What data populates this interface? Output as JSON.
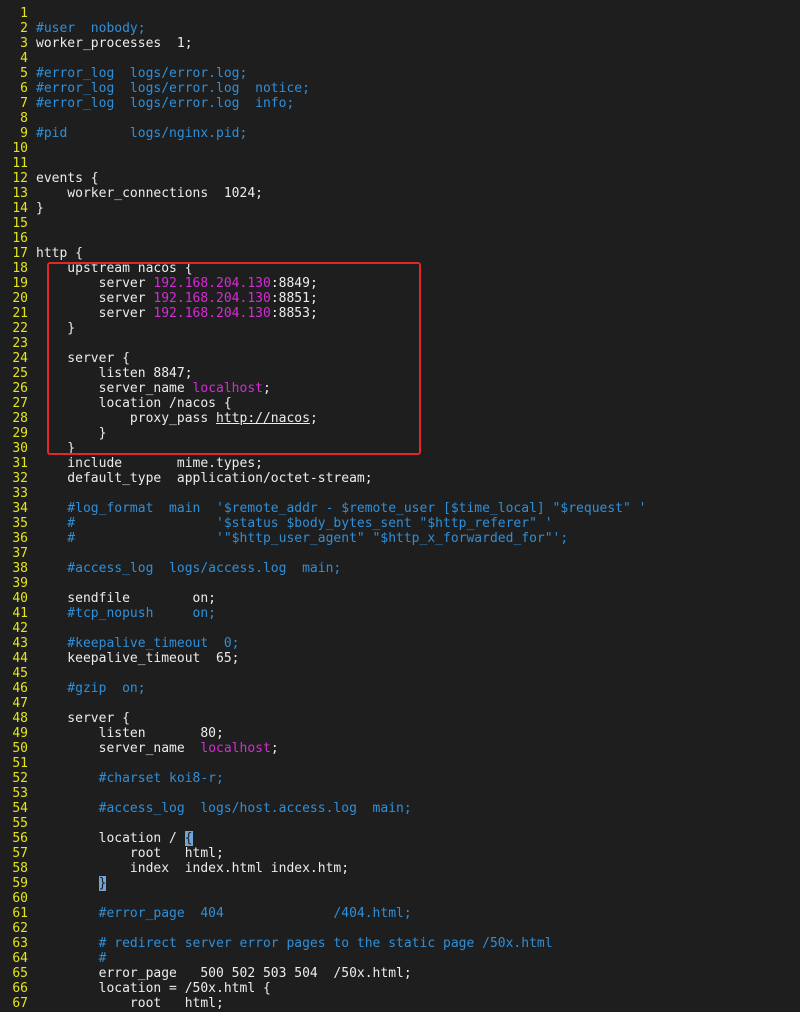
{
  "colors": {
    "background": "#1e1e1e",
    "line_number": "#e5e51c",
    "text": "#ececec",
    "comment": "#2f8fd8",
    "string": "#d62bd6",
    "highlight_box": "#e02828"
  },
  "lines": [
    {
      "n": "1",
      "segs": []
    },
    {
      "n": "2",
      "segs": [
        {
          "t": "#user  nobody;",
          "c": "c"
        }
      ]
    },
    {
      "n": "3",
      "segs": [
        {
          "t": "worker_processes  1;"
        }
      ]
    },
    {
      "n": "4",
      "segs": []
    },
    {
      "n": "5",
      "segs": [
        {
          "t": "#error_log  logs/error.log;",
          "c": "c"
        }
      ]
    },
    {
      "n": "6",
      "segs": [
        {
          "t": "#error_log  logs/error.log  notice;",
          "c": "c"
        }
      ]
    },
    {
      "n": "7",
      "segs": [
        {
          "t": "#error_log  logs/error.log  info;",
          "c": "c"
        }
      ]
    },
    {
      "n": "8",
      "segs": []
    },
    {
      "n": "9",
      "segs": [
        {
          "t": "#pid        logs/nginx.pid;",
          "c": "c"
        }
      ]
    },
    {
      "n": "10",
      "segs": []
    },
    {
      "n": "11",
      "segs": []
    },
    {
      "n": "12",
      "segs": [
        {
          "t": "events {"
        }
      ]
    },
    {
      "n": "13",
      "segs": [
        {
          "t": "    worker_connections  1024;"
        }
      ]
    },
    {
      "n": "14",
      "segs": [
        {
          "t": "}"
        }
      ]
    },
    {
      "n": "15",
      "segs": []
    },
    {
      "n": "16",
      "segs": []
    },
    {
      "n": "17",
      "segs": [
        {
          "t": "http {"
        }
      ]
    },
    {
      "n": "18",
      "segs": [
        {
          "t": "    upstream nacos {"
        }
      ]
    },
    {
      "n": "19",
      "segs": [
        {
          "t": "        server "
        },
        {
          "t": "192.168.204.130",
          "c": "m"
        },
        {
          "t": ":8849;"
        }
      ]
    },
    {
      "n": "20",
      "segs": [
        {
          "t": "        server "
        },
        {
          "t": "192.168.204.130",
          "c": "m"
        },
        {
          "t": ":8851;"
        }
      ]
    },
    {
      "n": "21",
      "segs": [
        {
          "t": "        server "
        },
        {
          "t": "192.168.204.130",
          "c": "m"
        },
        {
          "t": ":8853;"
        }
      ]
    },
    {
      "n": "22",
      "segs": [
        {
          "t": "    }"
        }
      ]
    },
    {
      "n": "23",
      "segs": []
    },
    {
      "n": "24",
      "segs": [
        {
          "t": "    server {"
        }
      ]
    },
    {
      "n": "25",
      "segs": [
        {
          "t": "        listen 8847;"
        }
      ]
    },
    {
      "n": "26",
      "segs": [
        {
          "t": "        server_name "
        },
        {
          "t": "localhost",
          "c": "m"
        },
        {
          "t": ";"
        }
      ]
    },
    {
      "n": "27",
      "segs": [
        {
          "t": "        location /nacos {"
        }
      ]
    },
    {
      "n": "28",
      "segs": [
        {
          "t": "            proxy_pass "
        },
        {
          "t": "http://nacos",
          "c": "u"
        },
        {
          "t": ";"
        }
      ]
    },
    {
      "n": "29",
      "segs": [
        {
          "t": "        }"
        }
      ]
    },
    {
      "n": "30",
      "segs": [
        {
          "t": "    }"
        }
      ]
    },
    {
      "n": "31",
      "segs": [
        {
          "t": "    include       mime.types;"
        }
      ]
    },
    {
      "n": "32",
      "segs": [
        {
          "t": "    default_type  application/octet-stream;"
        }
      ]
    },
    {
      "n": "33",
      "segs": []
    },
    {
      "n": "34",
      "segs": [
        {
          "t": "    #log_format  main  '$remote_addr - $remote_user [$time_local] \"$request\" '",
          "c": "c"
        }
      ]
    },
    {
      "n": "35",
      "segs": [
        {
          "t": "    #                  '$status $body_bytes_sent \"$http_referer\" '",
          "c": "c"
        }
      ]
    },
    {
      "n": "36",
      "segs": [
        {
          "t": "    #                  '\"$http_user_agent\" \"$http_x_forwarded_for\"';",
          "c": "c"
        }
      ]
    },
    {
      "n": "37",
      "segs": []
    },
    {
      "n": "38",
      "segs": [
        {
          "t": "    #access_log  logs/access.log  main;",
          "c": "c"
        }
      ]
    },
    {
      "n": "39",
      "segs": []
    },
    {
      "n": "40",
      "segs": [
        {
          "t": "    sendfile        on;"
        }
      ]
    },
    {
      "n": "41",
      "segs": [
        {
          "t": "    #tcp_nopush     on;",
          "c": "c"
        }
      ]
    },
    {
      "n": "42",
      "segs": []
    },
    {
      "n": "43",
      "segs": [
        {
          "t": "    #keepalive_timeout  0;",
          "c": "c"
        }
      ]
    },
    {
      "n": "44",
      "segs": [
        {
          "t": "    keepalive_timeout  65;"
        }
      ]
    },
    {
      "n": "45",
      "segs": []
    },
    {
      "n": "46",
      "segs": [
        {
          "t": "    #gzip  on;",
          "c": "c"
        }
      ]
    },
    {
      "n": "47",
      "segs": []
    },
    {
      "n": "48",
      "segs": [
        {
          "t": "    server {"
        }
      ]
    },
    {
      "n": "49",
      "segs": [
        {
          "t": "        listen       80;"
        }
      ]
    },
    {
      "n": "50",
      "segs": [
        {
          "t": "        server_name  "
        },
        {
          "t": "localhost",
          "c": "m"
        },
        {
          "t": ";"
        }
      ]
    },
    {
      "n": "51",
      "segs": []
    },
    {
      "n": "52",
      "segs": [
        {
          "t": "        #charset koi8-r;",
          "c": "c"
        }
      ]
    },
    {
      "n": "53",
      "segs": []
    },
    {
      "n": "54",
      "segs": [
        {
          "t": "        #access_log  logs/host.access.log  main;",
          "c": "c"
        }
      ]
    },
    {
      "n": "55",
      "segs": []
    },
    {
      "n": "56",
      "segs": [
        {
          "t": "        location / "
        },
        {
          "t": "{",
          "c": "cur"
        }
      ]
    },
    {
      "n": "57",
      "segs": [
        {
          "t": "            root   html;"
        }
      ]
    },
    {
      "n": "58",
      "segs": [
        {
          "t": "            index  index.html index.htm;"
        }
      ]
    },
    {
      "n": "59",
      "segs": [
        {
          "t": "        "
        },
        {
          "t": "}",
          "c": "cur"
        }
      ]
    },
    {
      "n": "60",
      "segs": []
    },
    {
      "n": "61",
      "segs": [
        {
          "t": "        #error_page  404              /404.html;",
          "c": "c"
        }
      ]
    },
    {
      "n": "62",
      "segs": []
    },
    {
      "n": "63",
      "segs": [
        {
          "t": "        # redirect server error pages to the static page /50x.html",
          "c": "c"
        }
      ]
    },
    {
      "n": "64",
      "segs": [
        {
          "t": "        #",
          "c": "c"
        }
      ]
    },
    {
      "n": "65",
      "segs": [
        {
          "t": "        error_page   500 502 503 504  /50x.html;"
        }
      ]
    },
    {
      "n": "66",
      "segs": [
        {
          "t": "        location = /50x.html {"
        }
      ]
    },
    {
      "n": "67",
      "segs": [
        {
          "t": "            root   html;"
        }
      ]
    }
  ]
}
